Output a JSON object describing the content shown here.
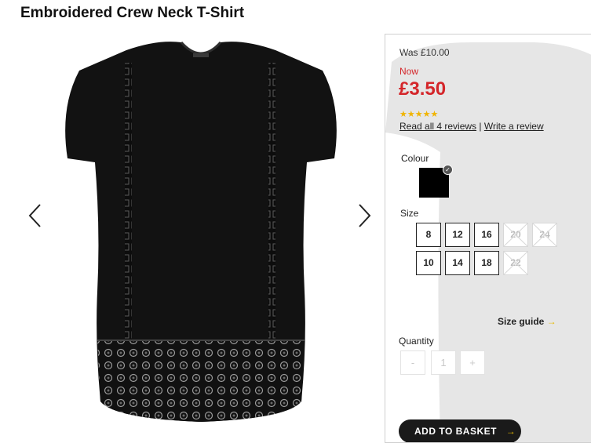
{
  "product": {
    "title": "Embroidered Crew Neck T-Shirt"
  },
  "gallery": {
    "prev_icon": "chevron-left-icon",
    "next_icon": "chevron-right-icon"
  },
  "pricing": {
    "was": "Was £10.00",
    "now_label": "Now",
    "price": "£3.50",
    "price_color": "#d4262a"
  },
  "rating": {
    "stars": "★★★★★",
    "value": 4.5,
    "max": 5,
    "read_reviews": "Read all 4 reviews",
    "separator": " | ",
    "write_review": "Write a review"
  },
  "colour": {
    "label": "Colour",
    "selected": "#000000"
  },
  "size": {
    "label": "Size",
    "options": [
      {
        "label": "8",
        "available": true
      },
      {
        "label": "12",
        "available": true
      },
      {
        "label": "16",
        "available": true
      },
      {
        "label": "20",
        "available": false
      },
      {
        "label": "24",
        "available": false
      },
      {
        "label": "10",
        "available": true
      },
      {
        "label": "14",
        "available": true
      },
      {
        "label": "18",
        "available": true
      },
      {
        "label": "22",
        "available": false
      }
    ],
    "guide": "Size guide",
    "guide_arrow": "→"
  },
  "quantity": {
    "label": "Quantity",
    "minus": "-",
    "value": "1",
    "plus": "+"
  },
  "basket": {
    "label": "ADD TO BASKET",
    "arrow": "→"
  }
}
